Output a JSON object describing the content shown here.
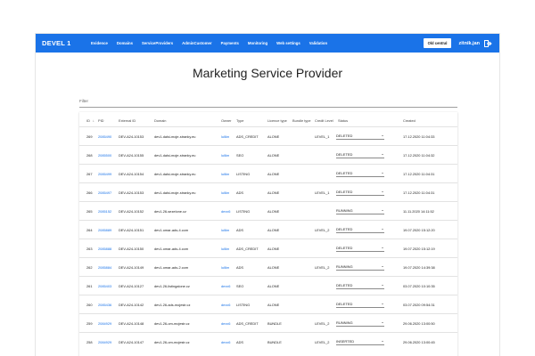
{
  "nav": {
    "brand": "DEVEL 1",
    "items": [
      "Evidence",
      "Domains",
      "ServiceProviders",
      "AdminCustomer",
      "Payments",
      "Monitoring",
      "Web settings",
      "Validation"
    ],
    "old_central": "Old central",
    "user": "zitnik.jan",
    "logout_icon": "logout-icon"
  },
  "page": {
    "title": "Marketing Service Provider",
    "filter_placeholder": "Filter"
  },
  "table": {
    "headers": [
      "ID",
      "PID",
      "External ID",
      "Domain",
      "Owner",
      "Type",
      "Licence type",
      "Bundle type",
      "Credit Level",
      "Status",
      "Created"
    ],
    "rows": [
      {
        "id": "269",
        "pid": "2085490",
        "ext": "DEV-A24-10153",
        "domain": "dev1-dalsi-moje-stranky.eu",
        "owner": "lul6m",
        "type": "ADS_CREDIT",
        "licence": "ALONE",
        "bundle": "",
        "level": "LEVEL_1",
        "status": "DELETED",
        "created": "17.12.2020 11:04:33"
      },
      {
        "id": "268",
        "pid": "2085500",
        "ext": "DEV-A24-10155",
        "domain": "dev1-dalsi-moje-stranky.eu",
        "owner": "lul6m",
        "type": "SEO",
        "licence": "ALONE",
        "bundle": "",
        "level": "",
        "status": "DELETED",
        "created": "17.12.2020 11:04:32"
      },
      {
        "id": "267",
        "pid": "2085499",
        "ext": "DEV-A24-10154",
        "domain": "dev1-dalsi-moje-stranky.eu",
        "owner": "lul6m",
        "type": "LISTING",
        "licence": "ALONE",
        "bundle": "",
        "level": "",
        "status": "DELETED",
        "created": "17.12.2020 11:04:31"
      },
      {
        "id": "266",
        "pid": "2085497",
        "ext": "DEV-A24-10153",
        "domain": "dev1-dalsi-moje-stranky.eu",
        "owner": "lul6m",
        "type": "ADS",
        "licence": "ALONE",
        "bundle": "",
        "level": "LEVEL_1",
        "status": "DELETED",
        "created": "17.12.2020 11:04:31"
      },
      {
        "id": "265",
        "pid": "2085152",
        "ext": "DEV-A24-10152",
        "domain": "dev1-26-sezelone.cz",
        "owner": "dexx6",
        "type": "LISTING",
        "licence": "ALONE",
        "bundle": "",
        "level": "",
        "status": "RUNNING",
        "created": "11.11.2020 14:11:52"
      },
      {
        "id": "264",
        "pid": "2085889",
        "ext": "DEV-A24-10151",
        "domain": "dev1-omar-ads-4.com",
        "owner": "lul6m",
        "type": "ADS",
        "licence": "ALONE",
        "bundle": "",
        "level": "LEVEL_2",
        "status": "DELETED",
        "created": "19.07.2020 15:12:20"
      },
      {
        "id": "263",
        "pid": "2085888",
        "ext": "DEV-A24-10150",
        "domain": "dev1-omar-ads-4.com",
        "owner": "lul6m",
        "type": "ADS_CREDIT",
        "licence": "ALONE",
        "bundle": "",
        "level": "",
        "status": "DELETED",
        "created": "19.07.2020 15:12:19"
      },
      {
        "id": "262",
        "pid": "2085884",
        "ext": "DEV-A24-10149",
        "domain": "dev1-omar-ads-2.com",
        "owner": "lul6m",
        "type": "ADS",
        "licence": "ALONE",
        "bundle": "",
        "level": "LEVEL_2",
        "status": "RUNNING",
        "created": "19.07.2020 14:39:38"
      },
      {
        "id": "261",
        "pid": "2085403",
        "ext": "DEV-A24-10127",
        "domain": "dev1-26-listingalone.cz",
        "owner": "dexx6",
        "type": "SEO",
        "licence": "ALONE",
        "bundle": "",
        "level": "",
        "status": "DELETED",
        "created": "03.07.2020 10:10:35"
      },
      {
        "id": "260",
        "pid": "2085436",
        "ext": "DEV-A24-10142",
        "domain": "dev1-26-ads-mojestr.cz",
        "owner": "dexx6",
        "type": "LISTING",
        "licence": "ALONE",
        "bundle": "",
        "level": "",
        "status": "DELETED",
        "created": "03.07.2020 09:54:31"
      },
      {
        "id": "259",
        "pid": "2084929",
        "ext": "DEV-A24-10148",
        "domain": "dev1-26-om-mojestr.cz",
        "owner": "dexx6",
        "type": "ADS_CREDIT",
        "licence": "BUNDLE",
        "bundle": "",
        "level": "LEVEL_2",
        "status": "RUNNING",
        "created": "29.06.2020 13:00:50"
      },
      {
        "id": "258",
        "pid": "2084929",
        "ext": "DEV-A24-10147",
        "domain": "dev1-26-om-mojestr.cz",
        "owner": "dexx6",
        "type": "ADS",
        "licence": "BUNDLE",
        "bundle": "",
        "level": "LEVEL_2",
        "status": "INSERTED",
        "created": "29.06.2020 13:00:45"
      }
    ]
  }
}
